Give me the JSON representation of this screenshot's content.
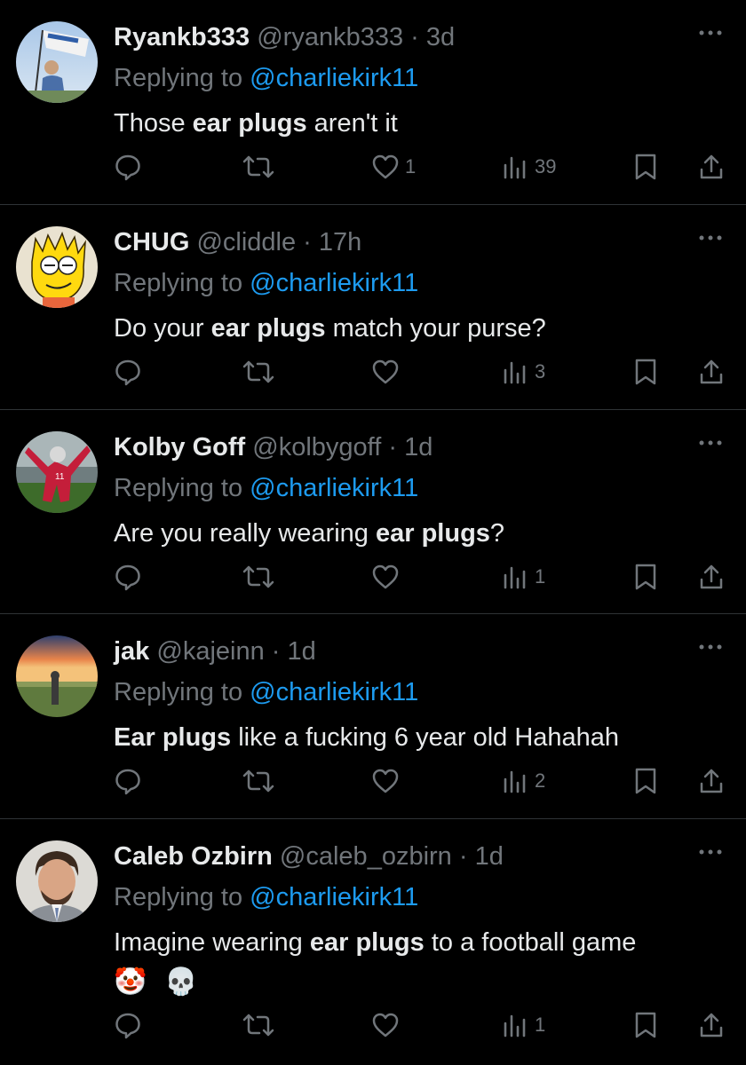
{
  "tweets": [
    {
      "name": "Ryankb333",
      "handle": "@ryankb333",
      "time": "3d",
      "replying_prefix": "Replying to ",
      "replying_handle": "@charliekirk11",
      "text_before": "Those ",
      "text_bold": "ear plugs",
      "text_after": " aren't it",
      "likes": "1",
      "views": "39",
      "avatar": "flag-waving-person"
    },
    {
      "name": "CHUG",
      "handle": "@cliddle",
      "time": "17h",
      "replying_prefix": "Replying to ",
      "replying_handle": "@charliekirk11",
      "text_before": "Do your ",
      "text_bold": "ear plugs",
      "text_after": " match your purse?",
      "likes": "",
      "views": "3",
      "avatar": "cartoon-character"
    },
    {
      "name": "Kolby Goff",
      "handle": "@kolbygoff",
      "time": "1d",
      "replying_prefix": "Replying to ",
      "replying_handle": "@charliekirk11",
      "text_before": "Are you really wearing ",
      "text_bold": "ear plugs",
      "text_after": "?",
      "likes": "",
      "views": "1",
      "avatar": "football-player"
    },
    {
      "name": "jak",
      "handle": "@kajeinn",
      "time": "1d",
      "replying_prefix": "Replying to ",
      "replying_handle": "@charliekirk11",
      "text_before": "",
      "text_bold": "Ear plugs",
      "text_after": " like a fucking 6 year old Hahahah",
      "likes": "",
      "views": "2",
      "avatar": "sunset-figure"
    },
    {
      "name": "Caleb Ozbirn",
      "handle": "@caleb_ozbirn",
      "time": "1d",
      "replying_prefix": "Replying to ",
      "replying_handle": "@charliekirk11",
      "text_before": "Imagine wearing ",
      "text_bold": "ear plugs",
      "text_after": " to a football game",
      "emojis": [
        "🤡",
        "💀"
      ],
      "likes": "",
      "views": "1",
      "avatar": "portrait-man"
    }
  ],
  "separator": "·",
  "colors": {
    "background": "#000000",
    "text": "#e7e9ea",
    "muted": "#71767b",
    "link": "#1d9bf0",
    "divider": "#2f3336"
  }
}
